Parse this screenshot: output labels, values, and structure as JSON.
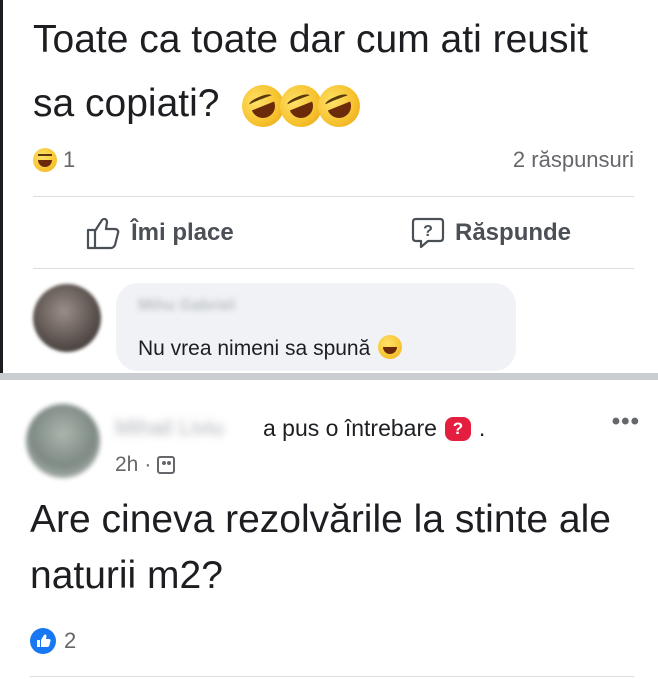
{
  "first_post": {
    "text": "Toate ca toate dar cum ati reusit sa copiati?",
    "emoji": [
      "rofl-emoji",
      "rofl-emoji",
      "rofl-emoji"
    ],
    "reaction_icon": "laughing-face-icon",
    "reaction_count": "1",
    "replies_count": "2 răspunsuri",
    "like_label": "Îmi place",
    "reply_label": "Răspunde"
  },
  "comment": {
    "author": "Mihu Gabriel",
    "text": "Nu vrea nimeni sa spună",
    "emoji": "joy-emoji"
  },
  "second_post": {
    "author": "Mihail Liviu",
    "action": "a pus o întrebare",
    "action_end": ".",
    "badge": "?",
    "time": "2h",
    "meta_sep": "·",
    "audience_icon": "group-icon",
    "more": "•••",
    "text": "Are cineva rezolvările la stinte ale naturii m2?",
    "like_count": "2"
  },
  "colors": {
    "accent_blue": "#1877f2",
    "question_red": "#e41e3f",
    "muted_text": "#65676b",
    "bubble_bg": "#f0f2f5"
  }
}
